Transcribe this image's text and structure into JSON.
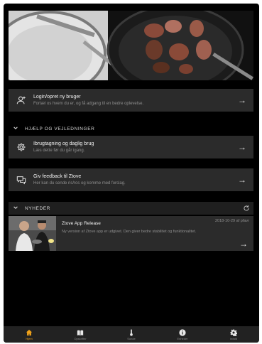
{
  "colors": {
    "accent": "#f0a21a",
    "card": "#2b2b2b",
    "background": "#000000"
  },
  "login": {
    "title": "Login/opret ny bruger",
    "subtitle": "Fortæl os hvem du er, og få adgang til en bedre oplevelse.",
    "icon": "add-user-icon"
  },
  "help_section": {
    "label": "HJÆLP OG VEJLEDNINGER"
  },
  "guide": {
    "title": "Ibrugtagning og daglig brug",
    "subtitle": "Læs dette før du går igang.",
    "icon": "gear-icon"
  },
  "feedback": {
    "title": "Giv feedback til Ztove",
    "subtitle": "Her kan du sende ris/ros og komme med forslag.",
    "icon": "chat-icon"
  },
  "news_section": {
    "label": "NYHEDER"
  },
  "news": [
    {
      "title": "Ztove App Release",
      "date": "2018-10-29 af pfavr",
      "body": "Ny version af Ztove app er udgivet. Den giver bedre stabilitet og funktionalitet."
    }
  ],
  "tabs": [
    {
      "label": "Hjem",
      "icon": "home-icon",
      "active": true
    },
    {
      "label": "Opskrifter",
      "icon": "book-icon",
      "active": false
    },
    {
      "label": "Sonde",
      "icon": "thermometer-icon",
      "active": false
    },
    {
      "label": "Enheder",
      "icon": "info-icon",
      "active": false
    },
    {
      "label": "Indstil",
      "icon": "gear-icon",
      "active": false
    }
  ]
}
